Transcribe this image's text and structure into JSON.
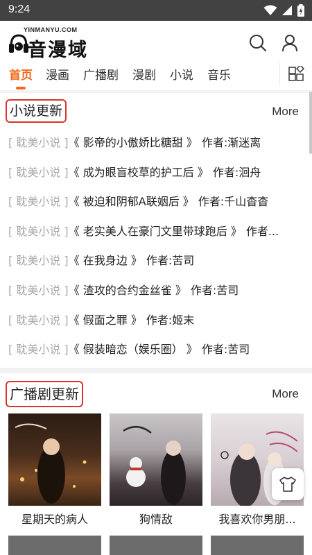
{
  "status_bar": {
    "time": "9:24"
  },
  "logo": {
    "top_text": "YINMANYU.COM",
    "main_text": "音漫域"
  },
  "tabs": [
    {
      "label": "首页",
      "active": true
    },
    {
      "label": "漫画",
      "active": false
    },
    {
      "label": "广播剧",
      "active": false
    },
    {
      "label": "漫剧",
      "active": false
    },
    {
      "label": "小说",
      "active": false
    },
    {
      "label": "音乐",
      "active": false
    }
  ],
  "novel_section": {
    "title": "小说更新",
    "more": "More",
    "items": [
      {
        "tag": "[ 耽美小说 ]",
        "title": "《 影帝的小傲娇比糖甜 》",
        "author_label": "作者:",
        "author": "渐迷离"
      },
      {
        "tag": "[ 耽美小说 ]",
        "title": "《 成为眼盲校草的护工后 》",
        "author_label": "作者:",
        "author": "洄舟"
      },
      {
        "tag": "[ 耽美小说 ]",
        "title": "《 被迫和阴郁A联姻后 》",
        "author_label": "作者:",
        "author": "千山杳杳"
      },
      {
        "tag": "[ 耽美小说 ]",
        "title": "《 老实美人在豪门文里带球跑后 》",
        "author_label": "作者...",
        "author": ""
      },
      {
        "tag": "[ 耽美小说 ]",
        "title": "《 在我身边 》",
        "author_label": "作者:",
        "author": "苦司"
      },
      {
        "tag": "[ 耽美小说 ]",
        "title": "《 渣攻的合约金丝雀 》",
        "author_label": "作者:",
        "author": "苦司"
      },
      {
        "tag": "[ 耽美小说 ]",
        "title": "《 假面之罪 》",
        "author_label": "作者:",
        "author": "姬末"
      },
      {
        "tag": "[ 耽美小说 ]",
        "title": "《 假装暗恋（娱乐圈） 》",
        "author_label": "作者:",
        "author": "苦司"
      }
    ]
  },
  "drama_section": {
    "title": "广播剧更新",
    "more": "More",
    "cards": [
      {
        "title": "星期天的病人"
      },
      {
        "title": "狗情敌"
      },
      {
        "title": "我喜欢你男朋..."
      }
    ]
  },
  "colors": {
    "accent": "#f26b1d",
    "highlight_border": "#d9352b",
    "status_bar": "#424242"
  },
  "icons": [
    "wifi-icon",
    "signal-icon",
    "battery-icon",
    "search-icon",
    "user-icon",
    "grid-icon",
    "tshirt-icon"
  ]
}
